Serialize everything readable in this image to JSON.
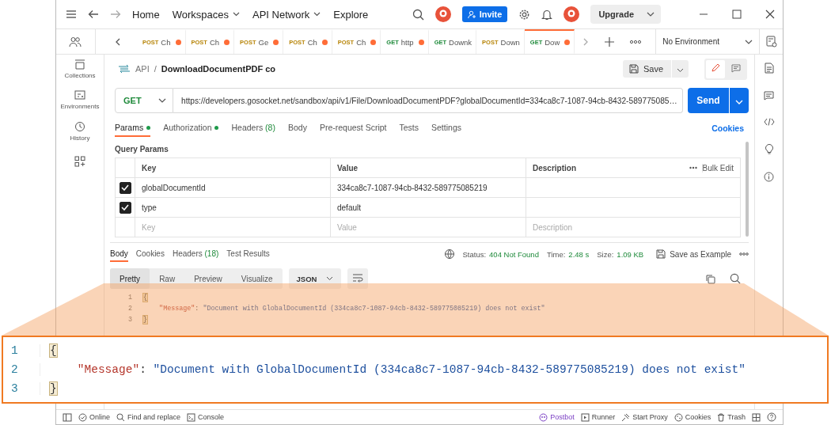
{
  "top_bar": {
    "nav": [
      {
        "label": "Home",
        "dropdown": false
      },
      {
        "label": "Workspaces",
        "dropdown": true
      },
      {
        "label": "API Network",
        "dropdown": true
      },
      {
        "label": "Explore",
        "dropdown": false
      }
    ],
    "invite": "Invite",
    "upgrade": "Upgrade"
  },
  "request_tabs": [
    {
      "method": "POST",
      "name": "Ch",
      "color": "#b8860b",
      "unsaved": true,
      "selected": false
    },
    {
      "method": "POST",
      "name": "Ch",
      "color": "#b8860b",
      "unsaved": true,
      "selected": false
    },
    {
      "method": "POST",
      "name": "Ge",
      "color": "#b8860b",
      "unsaved": true,
      "selected": false
    },
    {
      "method": "POST",
      "name": "Ch",
      "color": "#b8860b",
      "unsaved": true,
      "selected": false
    },
    {
      "method": "POST",
      "name": "Ch",
      "color": "#b8860b",
      "unsaved": true,
      "selected": false
    },
    {
      "method": "GET",
      "name": "http",
      "color": "#1f8a3b",
      "unsaved": true,
      "selected": false
    },
    {
      "method": "GET",
      "name": "Downk",
      "color": "#1f8a3b",
      "unsaved": false,
      "selected": false
    },
    {
      "method": "POST",
      "name": "Down",
      "color": "#b8860b",
      "unsaved": false,
      "selected": false
    },
    {
      "method": "GET",
      "name": "Dow",
      "color": "#1f8a3b",
      "unsaved": true,
      "selected": true
    }
  ],
  "environment": "No Environment",
  "sidebar": {
    "items": [
      "Collections",
      "Environments",
      "History"
    ]
  },
  "breadcrumb": {
    "parent": "API",
    "separator": "/",
    "title": "DownloadDocumentPDF co"
  },
  "save": "Save",
  "request": {
    "method": "GET",
    "url": "https://developers.gosocket.net/sandbox/api/v1/File/DownloadDocumentPDF?globalDocumentId=334ca8c7-1087-94cb-8432-589775085…"
  },
  "send": "Send",
  "request_sections": [
    {
      "label": "Params",
      "dot": true,
      "selected": true
    },
    {
      "label": "Authorization",
      "dot": true,
      "selected": false
    },
    {
      "label": "Headers",
      "count": "(8)",
      "dot": false,
      "selected": false
    },
    {
      "label": "Body",
      "dot": false,
      "selected": false
    },
    {
      "label": "Pre-request Script",
      "dot": false,
      "selected": false
    },
    {
      "label": "Tests",
      "dot": false,
      "selected": false
    },
    {
      "label": "Settings",
      "dot": false,
      "selected": false
    }
  ],
  "cookies": "Cookies",
  "query_params": {
    "title": "Query Params",
    "columns": [
      "Key",
      "Value",
      "Description"
    ],
    "bulk_edit": "Bulk Edit",
    "rows": [
      {
        "checked": true,
        "key": "globalDocumentId",
        "value": "334ca8c7-1087-94cb-8432-589775085219"
      },
      {
        "checked": true,
        "key": "type",
        "value": "default"
      }
    ],
    "placeholder_row": {
      "key": "Key",
      "value": "Value",
      "description": "Description"
    }
  },
  "response_tabs": [
    {
      "label": "Body",
      "selected": true
    },
    {
      "label": "Cookies",
      "selected": false
    },
    {
      "label": "Headers",
      "count": "(18)",
      "selected": false
    },
    {
      "label": "Test Results",
      "selected": false
    }
  ],
  "response_status": {
    "status_label": "Status:",
    "status": "404 Not Found",
    "time_label": "Time:",
    "time": "2.48 s",
    "size_label": "Size:",
    "size": "1.09 KB"
  },
  "save_example": "Save as Example",
  "view_modes": [
    {
      "label": "Pretty",
      "selected": true
    },
    {
      "label": "Raw",
      "selected": false
    },
    {
      "label": "Preview",
      "selected": false
    },
    {
      "label": "Visualize",
      "selected": false
    }
  ],
  "format": "JSON",
  "code": {
    "lines": [
      {
        "number": "1",
        "tokens": [
          {
            "kind": "bracket",
            "text": "{"
          }
        ]
      },
      {
        "number": "2",
        "tokens": [
          {
            "kind": "key",
            "text": "    \"Message\""
          },
          {
            "kind": "punct",
            "text": ": "
          },
          {
            "kind": "string",
            "text": "\"Document with GlobalDocumentId (334ca8c7-1087-94cb-8432-589775085219) does not exist\""
          }
        ]
      },
      {
        "number": "3",
        "tokens": [
          {
            "kind": "bracket",
            "text": "}"
          }
        ]
      }
    ]
  },
  "zoom_callout": {
    "lines": [
      {
        "number": "1",
        "tokens": [
          {
            "kind": "bracket",
            "text": "{"
          }
        ]
      },
      {
        "number": "2",
        "tokens": [
          {
            "kind": "key",
            "text": "    \"Message\""
          },
          {
            "kind": "punct",
            "text": ": "
          },
          {
            "kind": "string",
            "text": "\"Document with GlobalDocumentId (334ca8c7-1087-94cb-8432-589775085219) does not exist\""
          }
        ]
      },
      {
        "number": "3",
        "tokens": [
          {
            "kind": "bracket",
            "text": "}"
          }
        ]
      }
    ]
  },
  "status_bar": {
    "left": [
      "Online",
      "Find and replace",
      "Console"
    ],
    "right": [
      "Postbot",
      "Runner",
      "Start Proxy",
      "Cookies",
      "Trash"
    ]
  }
}
